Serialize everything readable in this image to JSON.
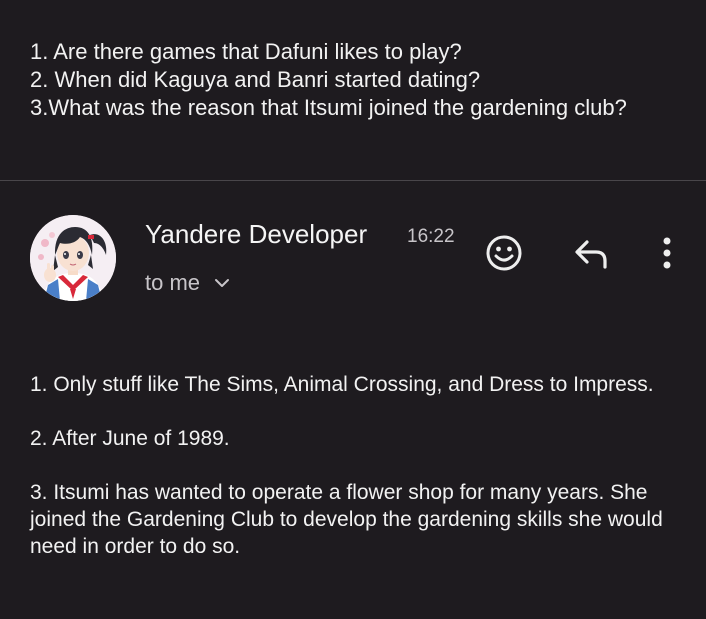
{
  "previous_message": {
    "lines": [
      "1. Are there games that Dafuni likes to play?",
      "2. When did Kaguya and Banri started dating?",
      "3.What was the reason that Itsumi joined the gardening club?"
    ]
  },
  "email_header": {
    "sender_name": "Yandere Developer",
    "time": "16:22",
    "recipient_label": "to me",
    "icons": {
      "avatar": "anime-girl-avatar",
      "recipient_toggle": "chevron-down-icon",
      "react": "emoji-smile-icon",
      "reply": "reply-arrow-icon",
      "more": "more-vertical-icon"
    }
  },
  "message_body": {
    "paragraphs": [
      "1. Only stuff like The Sims, Animal Crossing, and Dress to Impress.",
      "2. After June of 1989.",
      "3. Itsumi has wanted to operate a flower shop for many years. She joined the Gardening Club to develop the gardening skills she would need in order to do so."
    ]
  },
  "colors": {
    "background": "#1e1b1f",
    "text_primary": "#f2f2f2",
    "text_secondary": "#c8c5c9",
    "divider": "#49464a"
  }
}
